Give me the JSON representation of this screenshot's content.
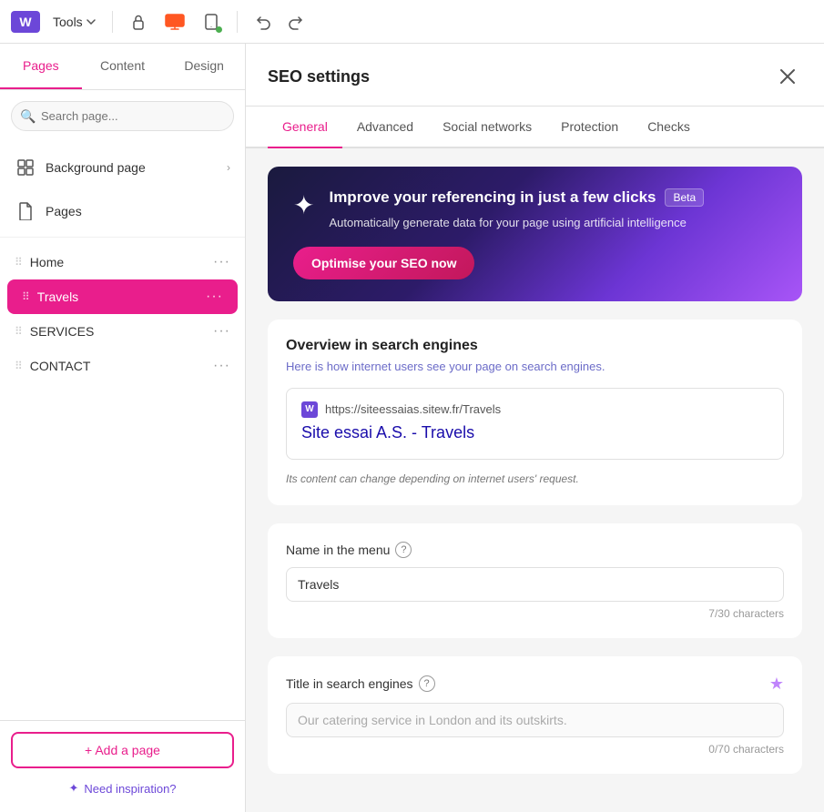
{
  "toolbar": {
    "logo": "W",
    "tools_label": "Tools",
    "undo_title": "Undo",
    "redo_title": "Redo"
  },
  "sidebar": {
    "tabs": [
      {
        "id": "pages",
        "label": "Pages"
      },
      {
        "id": "content",
        "label": "Content"
      },
      {
        "id": "design",
        "label": "Design"
      }
    ],
    "active_tab": "pages",
    "search_placeholder": "Search page...",
    "sections": [
      {
        "icon": "grid",
        "label": "Background page"
      },
      {
        "icon": "file",
        "label": "Pages"
      }
    ],
    "pages": [
      {
        "id": "home",
        "label": "Home"
      },
      {
        "id": "travels",
        "label": "Travels",
        "active": true
      },
      {
        "id": "services",
        "label": "SERVICES"
      },
      {
        "id": "contact",
        "label": "CONTACT"
      }
    ],
    "add_page_label": "+ Add a page",
    "inspiration_label": "Need inspiration?"
  },
  "seo": {
    "title": "SEO settings",
    "tabs": [
      {
        "id": "general",
        "label": "General",
        "active": true
      },
      {
        "id": "advanced",
        "label": "Advanced"
      },
      {
        "id": "social_networks",
        "label": "Social networks"
      },
      {
        "id": "protection",
        "label": "Protection"
      },
      {
        "id": "checks",
        "label": "Checks"
      }
    ],
    "ai_banner": {
      "title": "Improve your referencing in just a few clicks",
      "beta": "Beta",
      "subtitle": "Automatically generate data for your page using artificial intelligence",
      "button_label": "Optimise your SEO now"
    },
    "overview": {
      "title": "Overview in search engines",
      "subtitle": "Here is how internet users see your page on search engines.",
      "preview_url": "https://siteessaias.sitew.fr/Travels",
      "preview_site_name": "Site essai A.S. - Travels",
      "preview_note": "Its content can change depending on internet users' request."
    },
    "name_in_menu": {
      "label": "Name in the menu",
      "value": "Travels",
      "count": "7/30 characters"
    },
    "title_in_engines": {
      "label": "Title in search engines",
      "placeholder": "Our catering service in London and its outskirts.",
      "count": "0/70 characters"
    }
  }
}
